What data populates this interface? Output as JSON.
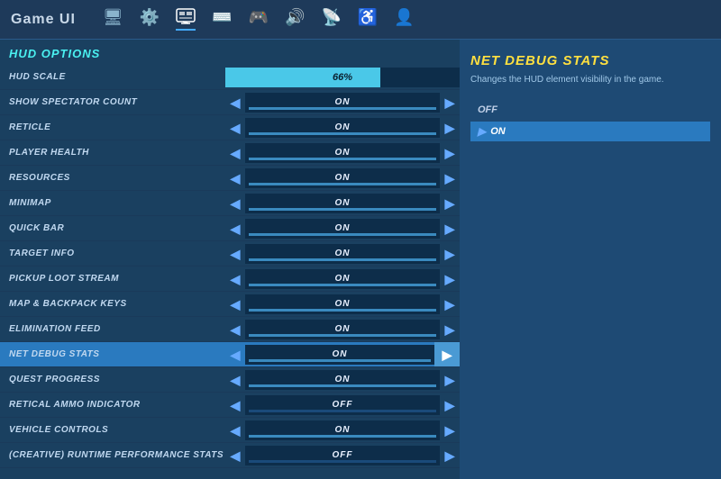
{
  "nav": {
    "title": "Game UI",
    "icons": [
      "🖥",
      "⚙",
      "🎮",
      "⌨",
      "🎮",
      "🔊",
      "📡",
      "🎮",
      "👤"
    ]
  },
  "left_panel": {
    "section_title": "HUD OPTIONS",
    "hud_scale": {
      "label": "HUD SCALE",
      "value": "66%",
      "fill_percent": 66
    },
    "settings": [
      {
        "label": "SHOW SPECTATOR COUNT",
        "value": "ON",
        "active": false
      },
      {
        "label": "RETICLE",
        "value": "ON",
        "active": false
      },
      {
        "label": "PLAYER HEALTH",
        "value": "ON",
        "active": false
      },
      {
        "label": "RESOURCES",
        "value": "ON",
        "active": false
      },
      {
        "label": "MINIMAP",
        "value": "ON",
        "active": false
      },
      {
        "label": "QUICK BAR",
        "value": "ON",
        "active": false
      },
      {
        "label": "TARGET INFO",
        "value": "ON",
        "active": false
      },
      {
        "label": "PICKUP LOOT STREAM",
        "value": "ON",
        "active": false
      },
      {
        "label": "MAP & BACKPACK KEYS",
        "value": "ON",
        "active": false
      },
      {
        "label": "ELIMINATION FEED",
        "value": "ON",
        "active": false
      },
      {
        "label": "NET DEBUG STATS",
        "value": "ON",
        "active": true
      },
      {
        "label": "QUEST PROGRESS",
        "value": "ON",
        "active": false
      },
      {
        "label": "RETICAL AMMO INDICATOR",
        "value": "OFF",
        "active": false
      },
      {
        "label": "VEHICLE CONTROLS",
        "value": "ON",
        "active": false
      },
      {
        "label": "(CREATIVE) RUNTIME PERFORMANCE STATS",
        "value": "OFF",
        "active": false
      }
    ]
  },
  "right_panel": {
    "title": "NET DEBUG STATS",
    "description": "Changes the HUD element visibility in the game.",
    "options": [
      {
        "label": "OFF",
        "selected": false
      },
      {
        "label": "ON",
        "selected": true
      }
    ]
  }
}
